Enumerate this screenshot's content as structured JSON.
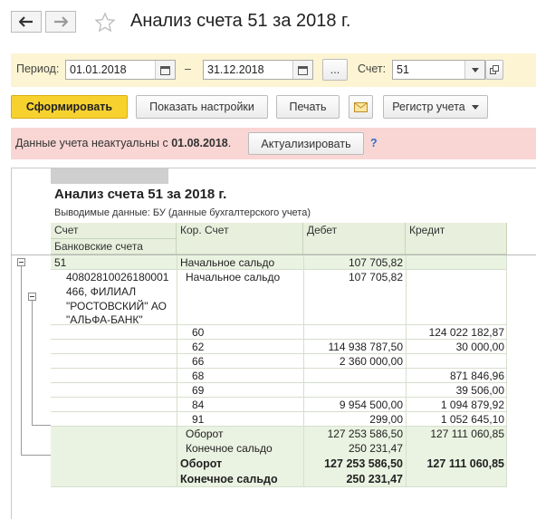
{
  "window": {
    "title": "Анализ счета 51 за 2018 г."
  },
  "nav": {
    "back_icon": "arrow-left-icon",
    "forward_icon": "arrow-right-icon",
    "favorite_icon": "star-icon"
  },
  "params": {
    "period_label": "Период:",
    "date_from": "01.01.2018",
    "dash": "–",
    "date_to": "31.12.2018",
    "ellipsis": "...",
    "account_label": "Счет:",
    "account_value": "51"
  },
  "toolbar": {
    "generate": "Сформировать",
    "show_settings": "Показать настройки",
    "print": "Печать",
    "register": "Регистр учета"
  },
  "warning": {
    "text": "Данные учета неактуальны с ",
    "date": "01.08.2018",
    "dot": ".",
    "update_button": "Актуализировать",
    "help": "?"
  },
  "report": {
    "title": "Анализ счета 51 за 2018 г.",
    "subtitle": "Выводимые данные:  БУ (данные бухгалтерского учета)",
    "headers": {
      "account": "Счет",
      "corr_account": "Кор. Счет",
      "debit": "Дебет",
      "credit": "Кредит",
      "bank_accounts": "Банковские счета"
    },
    "account_row": {
      "account": "51",
      "label": "Начальное сальдо",
      "debit": "107 705,82",
      "credit": ""
    },
    "bank": {
      "name_lines": [
        "40802810026180001",
        "466, ФИЛИАЛ",
        "\"РОСТОВСКИЙ\" АО",
        "\"АЛЬФА-БАНК\""
      ],
      "opening_label": "Начальное сальдо",
      "opening_debit": "107 705,82"
    },
    "corr_rows": [
      {
        "account": "60",
        "debit": "",
        "credit": "124 022 182,87"
      },
      {
        "account": "62",
        "debit": "114 938 787,50",
        "credit": "30 000,00"
      },
      {
        "account": "66",
        "debit": "2 360 000,00",
        "credit": ""
      },
      {
        "account": "68",
        "debit": "",
        "credit": "871 846,96"
      },
      {
        "account": "69",
        "debit": "",
        "credit": "39 506,00"
      },
      {
        "account": "84",
        "debit": "9 954 500,00",
        "credit": "1 094 879,92"
      },
      {
        "account": "91",
        "debit": "299,00",
        "credit": "1 052 645,10"
      }
    ],
    "bank_turnover": {
      "label": "Оборот",
      "debit": "127 253 586,50",
      "credit": "127 111 060,85"
    },
    "bank_closing": {
      "label": "Конечное сальдо",
      "debit": "250 231,47",
      "credit": ""
    },
    "total_turnover": {
      "label": "Оборот",
      "debit": "127 253 586,50",
      "credit": "127 111 060,85"
    },
    "total_closing": {
      "label": "Конечное сальдо",
      "debit": "250 231,47",
      "credit": ""
    }
  }
}
